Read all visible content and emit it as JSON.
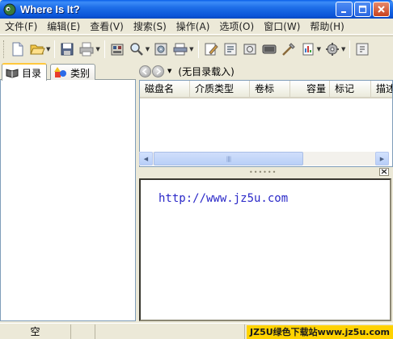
{
  "window": {
    "title": "Where Is It?"
  },
  "menu": [
    "文件(F)",
    "编辑(E)",
    "查看(V)",
    "搜索(S)",
    "操作(A)",
    "选项(O)",
    "窗口(W)",
    "帮助(H)"
  ],
  "toolbar": {
    "icons": [
      "new-file-icon",
      "open-folder-icon",
      "save-icon",
      "print-icon",
      "catalog-icon",
      "search-icon",
      "catalog-disk-icon",
      "scan-icon",
      "edit-icon",
      "properties-icon",
      "media-icon",
      "refresh-icon",
      "tools-icon",
      "report-icon",
      "options-icon",
      "help-icon"
    ]
  },
  "tabs": {
    "catalog": "目录",
    "category": "类别"
  },
  "nav": {
    "status": "(无目录载入)"
  },
  "list": {
    "columns": [
      "磁盘名",
      "介质类型",
      "卷标",
      "容量",
      "标记",
      "描述"
    ]
  },
  "memo": {
    "text": "http://www.jz5u.com"
  },
  "status": {
    "main": "空",
    "watermark": "JZ5U绿色下载站www.jz5u.com"
  },
  "colors": {
    "title_bar": "#0A5FE8",
    "memo_text": "#2A28C8",
    "tab_highlight": "#FFC83C",
    "watermark_bg": "#FFD200"
  }
}
